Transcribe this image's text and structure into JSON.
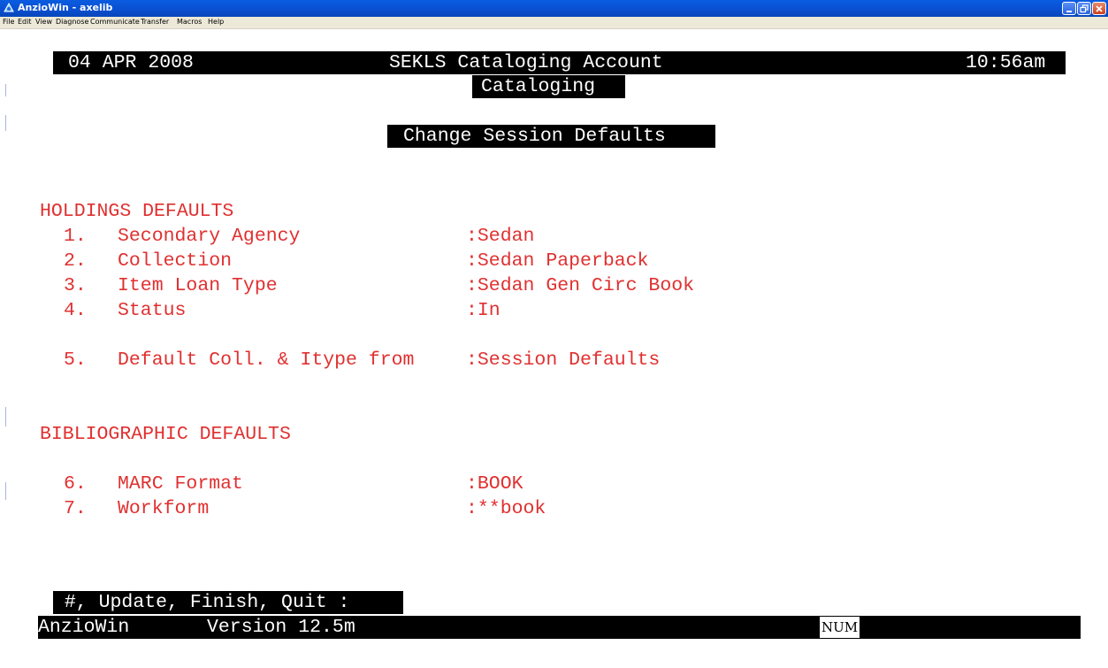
{
  "window": {
    "title": "AnzioWin - axelib",
    "minimize_label": "_",
    "maximize_label": "□",
    "close_label": "✕"
  },
  "menu": {
    "items": [
      "File",
      "Edit",
      "View",
      "Diagnose",
      "Communicate",
      "Transfer",
      "Macros",
      "Help"
    ]
  },
  "header": {
    "date": "04 APR 2008",
    "account": "SEKLS Cataloging Account",
    "time": "10:56am",
    "module": "Cataloging"
  },
  "screen_title": "Change Session Defaults",
  "holdings": {
    "heading": "HOLDINGS DEFAULTS",
    "items": [
      {
        "num": "1.",
        "label": "Secondary Agency",
        "value": ":Sedan"
      },
      {
        "num": "2.",
        "label": "Collection",
        "value": ":Sedan Paperback"
      },
      {
        "num": "3.",
        "label": "Item Loan Type",
        "value": ":Sedan Gen Circ Book"
      },
      {
        "num": "4.",
        "label": "Status",
        "value": ":In"
      },
      {
        "num": "5.",
        "label": "Default Coll. & Itype from",
        "value": ":Session Defaults"
      }
    ]
  },
  "bibliographic": {
    "heading": "BIBLIOGRAPHIC DEFAULTS",
    "items": [
      {
        "num": "6.",
        "label": "MARC Format",
        "value": ":BOOK"
      },
      {
        "num": "7.",
        "label": "Workform",
        "value": ":**book"
      }
    ]
  },
  "prompt": " #, Update, Finish, Quit : ",
  "statusbar": {
    "app": "AnzioWin",
    "version": "Version 12.5m",
    "num_indicator": "NUM"
  },
  "colors": {
    "terminal_text": "#e03030",
    "inverse_bg": "#000000",
    "inverse_fg": "#ffffff",
    "titlebar": "#0a5ce0"
  }
}
